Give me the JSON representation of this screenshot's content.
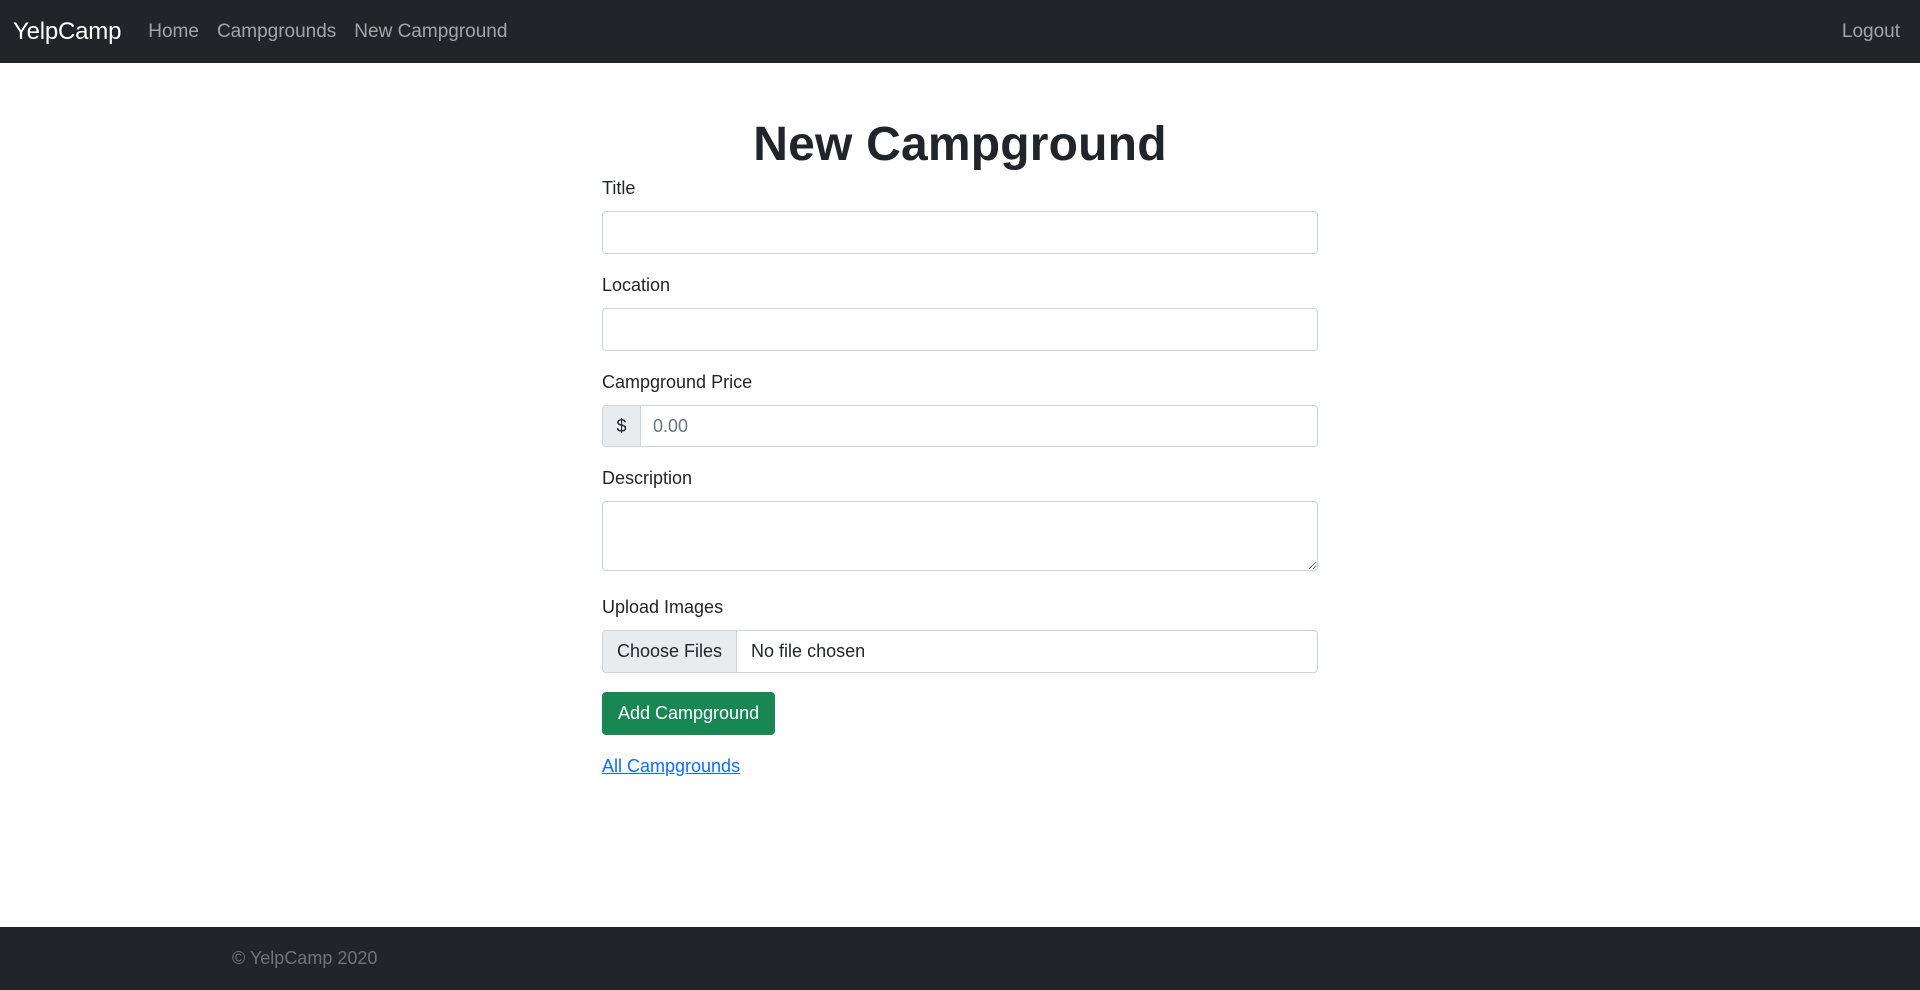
{
  "navbar": {
    "brand": "YelpCamp",
    "links": [
      "Home",
      "Campgrounds",
      "New Campground"
    ],
    "logout": "Logout"
  },
  "form": {
    "heading": "New Campground",
    "title": {
      "label": "Title",
      "value": ""
    },
    "location": {
      "label": "Location",
      "value": ""
    },
    "price": {
      "label": "Campground Price",
      "prefix": "$",
      "placeholder": "0.00",
      "value": ""
    },
    "description": {
      "label": "Description",
      "value": ""
    },
    "upload": {
      "label": "Upload Images",
      "button": "Choose Files",
      "status": "No file chosen"
    },
    "submit": "Add Campground",
    "back_link": "All Campgrounds"
  },
  "footer": {
    "text": "© YelpCamp 2020"
  },
  "colors": {
    "navbar_bg": "#212529",
    "submit_bg": "#198754",
    "link": "#0d6efd"
  }
}
